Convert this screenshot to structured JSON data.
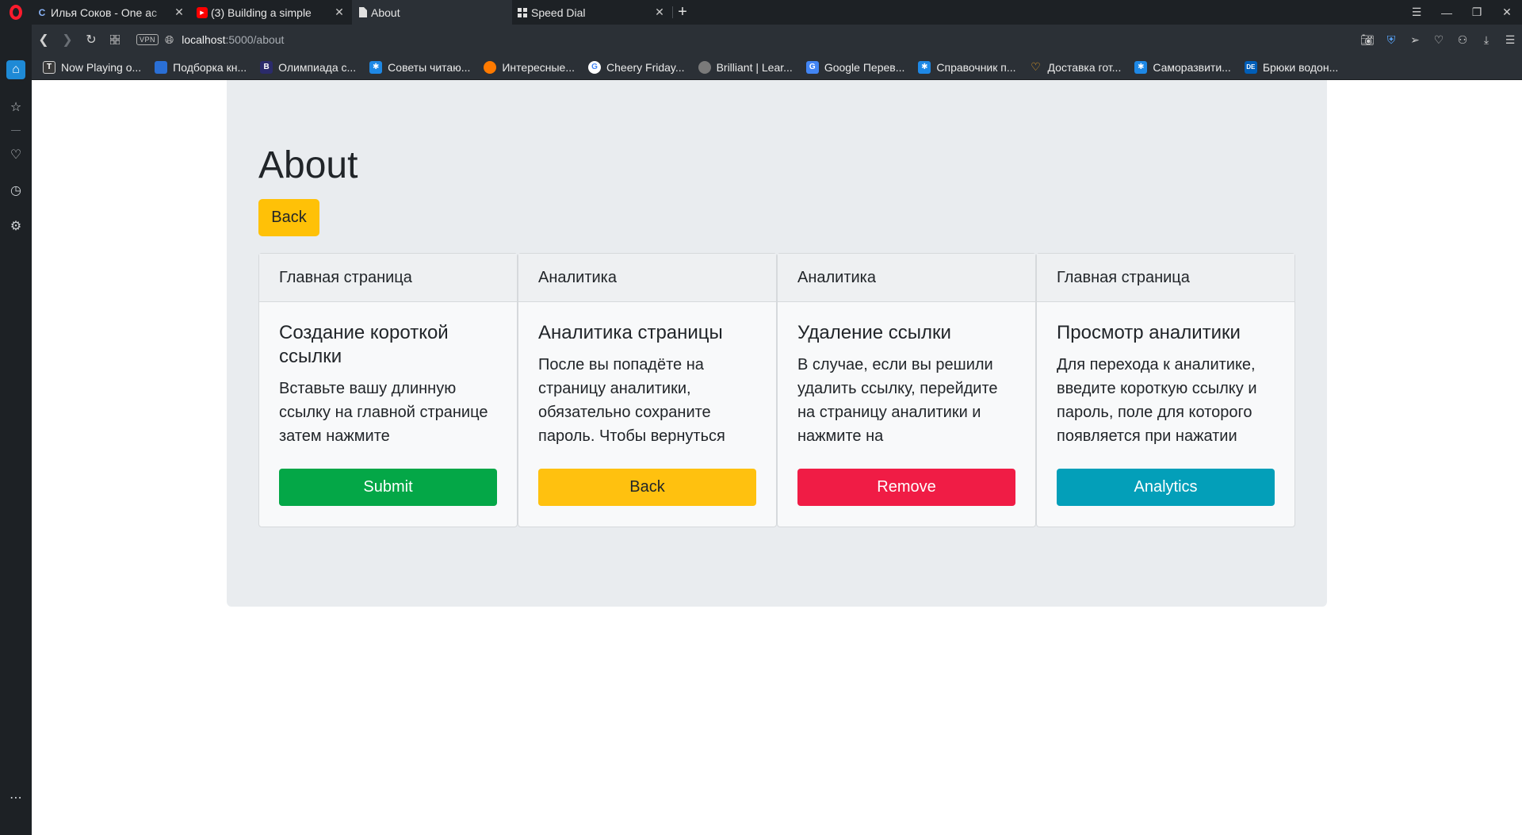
{
  "browser": {
    "tabs": [
      {
        "icon": "opera-c-icon",
        "title": "Илья Соков - One ac"
      },
      {
        "icon": "youtube-icon",
        "title": "(3) Building a simple"
      },
      {
        "icon": "document-icon",
        "title": "About"
      },
      {
        "icon": "speed-dial-icon",
        "title": "Speed Dial"
      }
    ],
    "address": {
      "vpn_label": "VPN",
      "host": "localhost",
      "path": ":5000/about"
    },
    "bookmarks": [
      {
        "label": "Now Playing o...",
        "color": "#3a3a3a"
      },
      {
        "label": "Подборка кн...",
        "color": "#2a6fd6"
      },
      {
        "label": "Олимпиада с...",
        "color": "#2b2b6b"
      },
      {
        "label": "Советы читаю...",
        "color": "#1e88e5"
      },
      {
        "label": "Интересные...",
        "color": "#ff7a00"
      },
      {
        "label": "Cheery Friday...",
        "color": "#ffffff"
      },
      {
        "label": "Brilliant | Lear...",
        "color": "#7a7a7a"
      },
      {
        "label": "Google Перев...",
        "color": "#4285f4"
      },
      {
        "label": "Справочник п...",
        "color": "#1e88e5"
      },
      {
        "label": "Доставка гот...",
        "color": "#f5a623"
      },
      {
        "label": "Саморазвити...",
        "color": "#1e88e5"
      },
      {
        "label": "Брюки водон...",
        "color": "#005eb8"
      }
    ]
  },
  "page": {
    "title": "About",
    "back_label": "Back",
    "cards": [
      {
        "header": "Главная страница",
        "title": "Создание короткой ссылки",
        "text": "Вставьте вашу длинную ссылку на главной странице затем нажмите",
        "button": "Submit",
        "button_color": "#04a747"
      },
      {
        "header": "Аналитика",
        "title": "Аналитика страницы",
        "text": "После вы попадёте на страницу аналитики, обязательно сохраните пароль. Чтобы вернуться",
        "button": "Back",
        "button_color": "#ffc10f"
      },
      {
        "header": "Аналитика",
        "title": "Удаление ссылки",
        "text": "В случае, если вы решили удалить ссылку, перейдите на страницу аналитики и нажмите на",
        "button": "Remove",
        "button_color": "#f01c45"
      },
      {
        "header": "Главная страница",
        "title": "Просмотр аналитики",
        "text": "Для перехода к аналитике, введите короткую ссылку и пароль, поле для которого появляется при нажатии",
        "button": "Analytics",
        "button_color": "#039fb9"
      }
    ]
  }
}
